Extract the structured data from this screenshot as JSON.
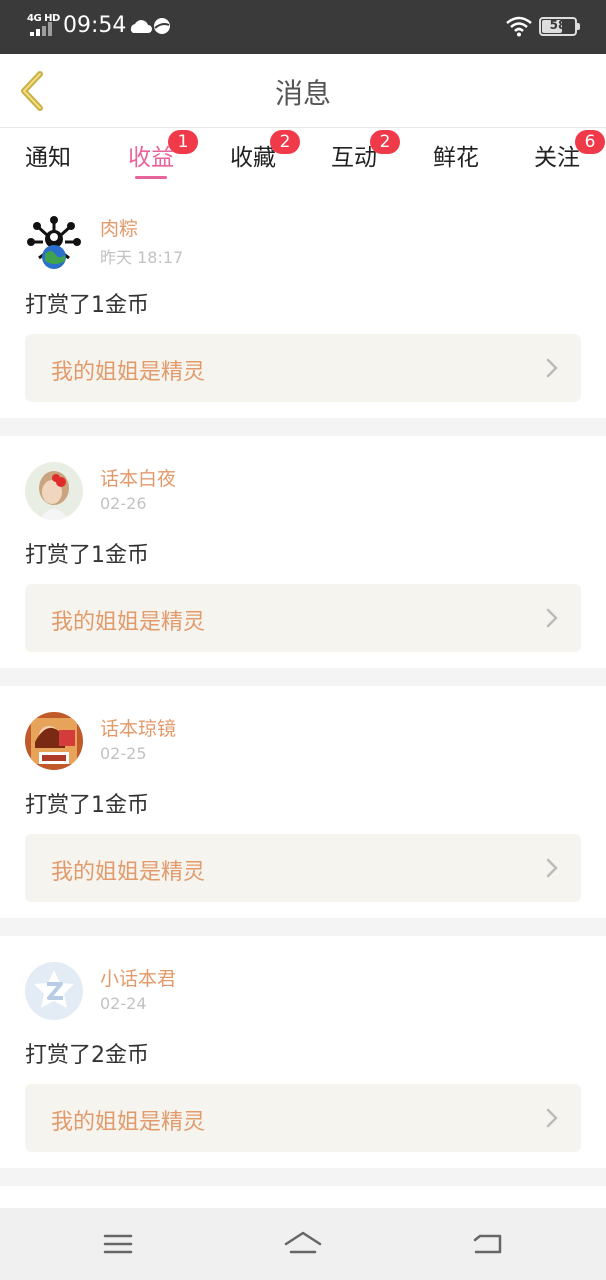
{
  "status_bar": {
    "network": "4G HD",
    "time": "09:54",
    "battery": "58",
    "icons": [
      "signal-icon",
      "weather-icon",
      "wifi-icon",
      "battery-icon"
    ]
  },
  "header": {
    "title": "消息",
    "back_icon": "back-chevron-icon",
    "accent_color": "#e8649a",
    "back_color": "#c9b042"
  },
  "tabs": [
    {
      "label": "通知",
      "badge": ""
    },
    {
      "label": "收益",
      "badge": "1",
      "active": true
    },
    {
      "label": "收藏",
      "badge": "2"
    },
    {
      "label": "互动",
      "badge": "2"
    },
    {
      "label": "鲜花",
      "badge": ""
    },
    {
      "label": "关注",
      "badge": "6"
    }
  ],
  "items": [
    {
      "user": "肉粽",
      "time": "昨天 18:17",
      "action": "打赏了1金币",
      "book": "我的姐姐是精灵",
      "avatar": "avatar-globe-icon"
    },
    {
      "user": "话本白夜",
      "time": "02-26",
      "action": "打赏了1金币",
      "book": "我的姐姐是精灵",
      "avatar": "avatar-girl-icon"
    },
    {
      "user": "话本琼镜",
      "time": "02-25",
      "action": "打赏了1金币",
      "book": "我的姐姐是精灵",
      "avatar": "avatar-character-icon"
    },
    {
      "user": "小话本君",
      "time": "02-24",
      "action": "打赏了2金币",
      "book": "我的姐姐是精灵",
      "avatar": "avatar-default-z-icon"
    }
  ],
  "system_nav": {
    "icons": [
      "menu-icon",
      "home-icon",
      "back-icon"
    ]
  },
  "colors": {
    "name": "#e39a6b",
    "badge": "#f03a4a",
    "book_bg": "#f5f4ee"
  }
}
